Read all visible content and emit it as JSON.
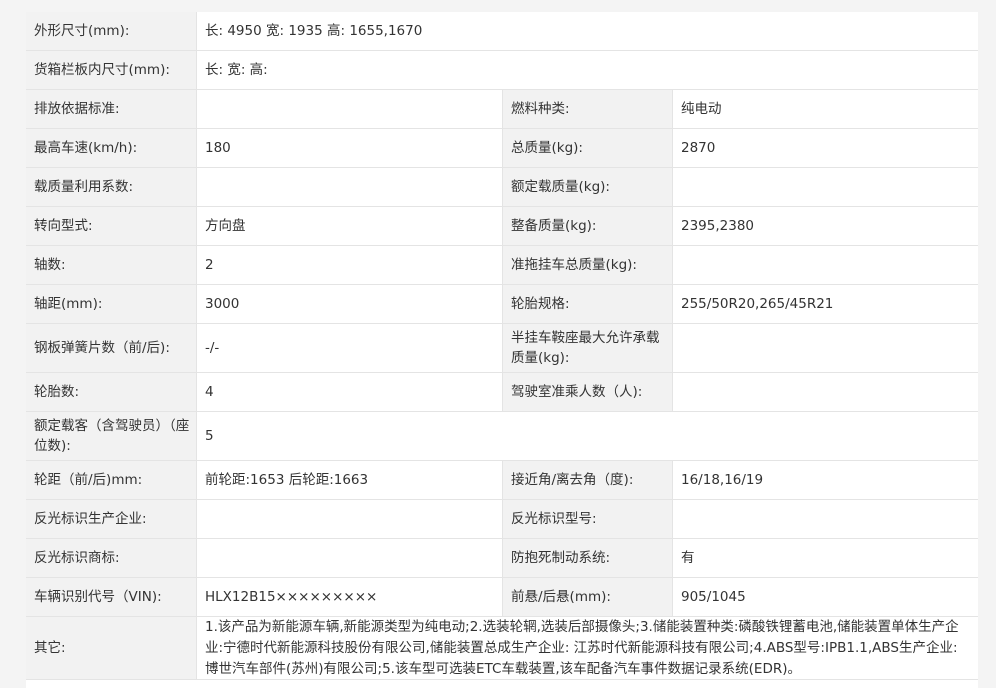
{
  "rows": [
    {
      "label": "外形尺寸(mm):",
      "value": "长:  4950  宽:  1935  高:  1655,1670"
    },
    {
      "label": "货箱栏板内尺寸(mm):",
      "value": "长:   宽:   高:"
    },
    {
      "label": "排放依据标准:",
      "value": "",
      "label2": "燃料种类:",
      "value2": "纯电动"
    },
    {
      "label": "最高车速(km/h):",
      "value": "180",
      "label2": "总质量(kg):",
      "value2": "2870"
    },
    {
      "label": "载质量利用系数:",
      "value": "",
      "label2": "额定载质量(kg):",
      "value2": ""
    },
    {
      "label": "转向型式:",
      "value": "方向盘",
      "label2": "整备质量(kg):",
      "value2": "2395,2380"
    },
    {
      "label": "轴数:",
      "value": "2",
      "label2": "准拖挂车总质量(kg):",
      "value2": ""
    },
    {
      "label": "轴距(mm):",
      "value": "3000",
      "label2": "轮胎规格:",
      "value2": "255/50R20,265/45R21"
    },
    {
      "label": "钢板弹簧片数（前/后):",
      "value": "-/-",
      "label2": "半挂车鞍座最大允许承载质量(kg):",
      "value2": ""
    },
    {
      "label": "轮胎数:",
      "value": "4",
      "label2": "驾驶室准乘人数（人):",
      "value2": ""
    },
    {
      "label": "额定载客（含驾驶员）（座位数):",
      "value": "5"
    },
    {
      "label": "轮距（前/后)mm:",
      "value": "前轮距:1653 后轮距:1663",
      "label2": "接近角/离去角（度):",
      "value2": "16/18,16/19"
    },
    {
      "label": "反光标识生产企业:",
      "value": "",
      "label2": "反光标识型号:",
      "value2": ""
    },
    {
      "label": "反光标识商标:",
      "value": "",
      "label2": "防抱死制动系统:",
      "value2": "有"
    },
    {
      "label": "车辆识别代号（VIN):",
      "value": "HLX12B15×××××××××",
      "label2": "前悬/后悬(mm):",
      "value2": "905/1045"
    },
    {
      "label": "其它:",
      "value": "1.该产品为新能源车辆,新能源类型为纯电动;2.选装轮辋,选装后部摄像头;3.储能装置种类:磷酸铁锂蓄电池,储能装置单体生产企业:宁德时代新能源科技股份有限公司,储能装置总成生产企业: 江苏时代新能源科技有限公司;4.ABS型号:IPB1.1,ABS生产企业:博世汽车部件(苏州)有限公司;5.该车型可选装ETC车载装置,该车配备汽车事件数据记录系统(EDR)。"
    }
  ]
}
